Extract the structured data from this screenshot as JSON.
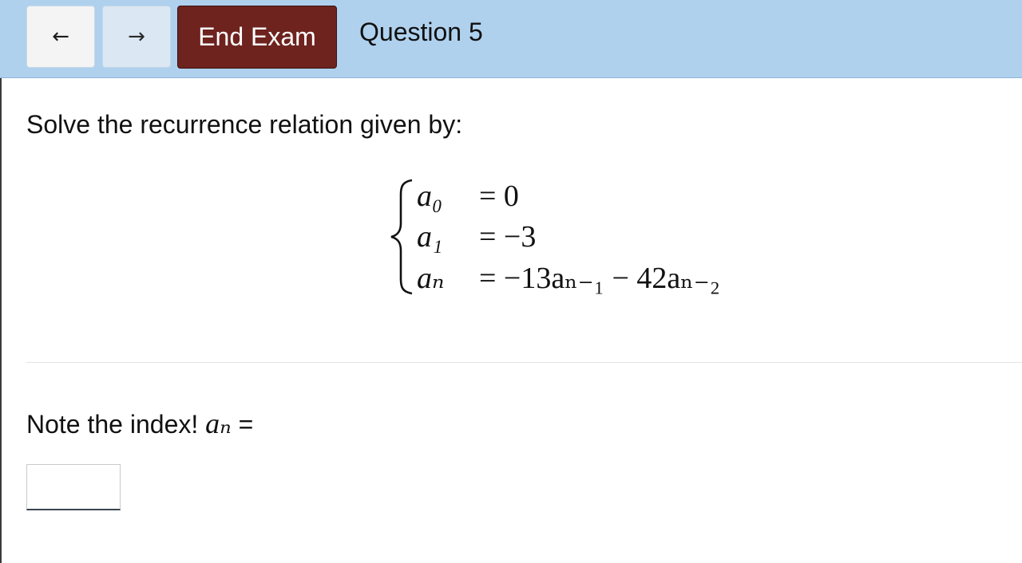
{
  "toolbar": {
    "back_symbol": "←",
    "forward_symbol": "→",
    "end_exam_label": "End Exam",
    "question_label": "Question 5",
    "back_icon": "left-arrow-icon",
    "forward_icon": "right-arrow-icon"
  },
  "colors": {
    "topbar_background": "#afd1ee",
    "end_exam_background": "#6e231e",
    "back_button_background": "#f4f4f4",
    "forward_button_background": "#dbe7f2"
  },
  "question": {
    "prompt": "Solve the recurrence relation given by:",
    "equations": [
      {
        "lhs": "a₀",
        "rhs": "= 0"
      },
      {
        "lhs": "a₁",
        "rhs": "= −3"
      },
      {
        "lhs": "aₙ",
        "rhs": "= −13aₙ₋₁ − 42aₙ₋₂"
      }
    ],
    "note_text": "Note the index!",
    "note_math": "aₙ",
    "note_equals": "=",
    "answer_value": ""
  }
}
